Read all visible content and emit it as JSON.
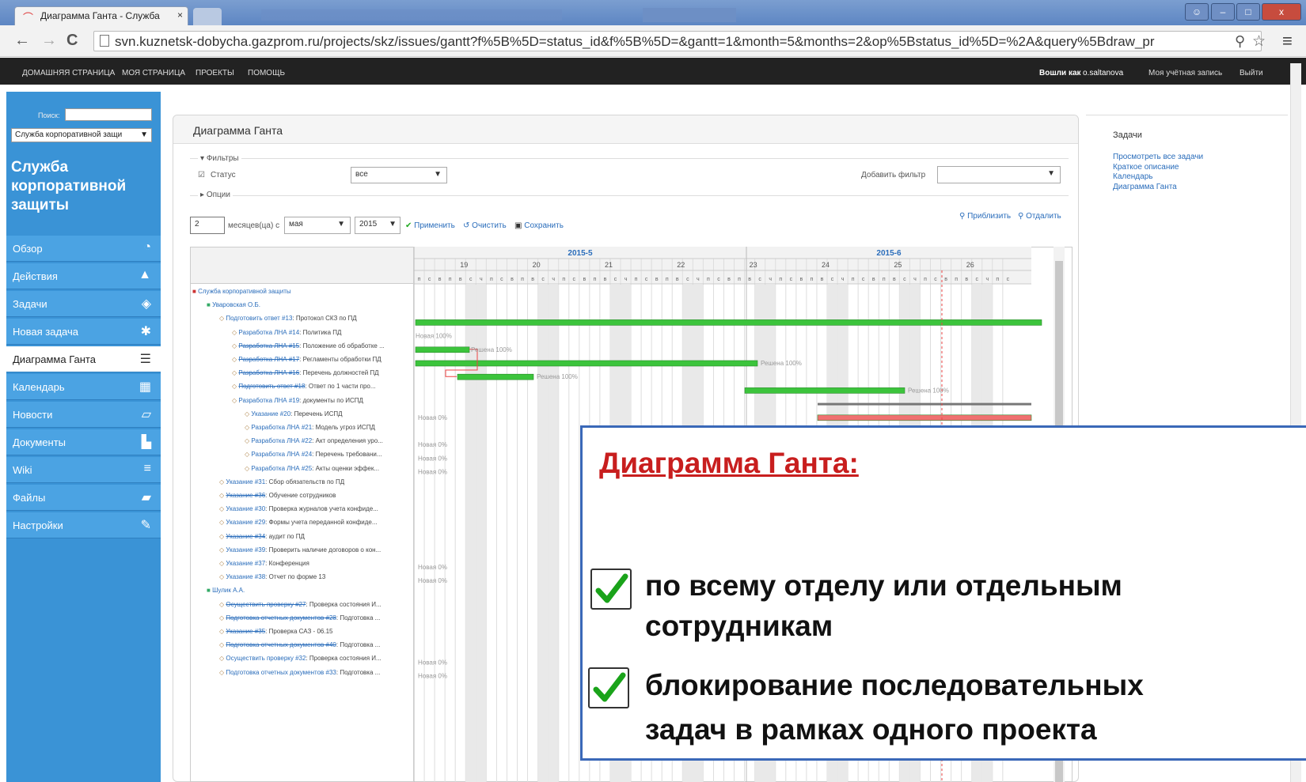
{
  "browser": {
    "tab_title": "Диаграмма Ганта - Служба",
    "url": "svn.kuznetsk-dobycha.gazprom.ru/projects/skz/issues/gantt?f%5B%5D=status_id&f%5B%5D=&gantt=1&month=5&months=2&op%5Bstatus_id%5D=%2A&query%5Bdraw_pr",
    "back": "←",
    "forward": "→",
    "reload": "C",
    "menu": "≡",
    "zoom_icon": "⚲",
    "star": "☆",
    "min": "–",
    "max": "□",
    "close": "x"
  },
  "topnav": {
    "home": "ДОМАШНЯЯ СТРАНИЦА",
    "mypage": "МОЯ СТРАНИЦА",
    "projects": "ПРОЕКТЫ",
    "help": "ПОМОЩЬ",
    "logged": "Вошли как",
    "user": "o.saltanova",
    "account": "Моя учётная запись",
    "logout": "Выйти"
  },
  "sidebar": {
    "search_label": "Поиск:",
    "project_select": "Служба корпоративной защи",
    "project_title": "Служба корпоративной защиты",
    "items": [
      {
        "label": "Обзор",
        "icon": "◔"
      },
      {
        "label": "Действия",
        "icon": "▲"
      },
      {
        "label": "Задачи",
        "icon": "◈"
      },
      {
        "label": "Новая задача",
        "icon": "✱"
      },
      {
        "label": "Диаграмма Ганта",
        "icon": "☰"
      },
      {
        "label": "Календарь",
        "icon": "▦"
      },
      {
        "label": "Новости",
        "icon": "▱"
      },
      {
        "label": "Документы",
        "icon": "▙"
      },
      {
        "label": "Wiki",
        "icon": "≡"
      },
      {
        "label": "Файлы",
        "icon": "▰"
      },
      {
        "label": "Настройки",
        "icon": "✎"
      }
    ]
  },
  "main": {
    "title": "Диаграмма Ганта",
    "filters_label": "Фильтры",
    "status_label": "Статус",
    "status_value": "все",
    "add_filter_label": "Добавить фильтр",
    "options_label": "Опции",
    "zoom_in": "Приблизить",
    "zoom_out": "Отдалить",
    "months_value": "2",
    "months_label": "месяцев(ца) с",
    "month_select": "мая",
    "year_select": "2015",
    "apply": "Применить",
    "clear": "Очистить",
    "save": "Сохранить"
  },
  "gantt": {
    "months": [
      "2015-5",
      "2015-6"
    ],
    "weeks": [
      "19",
      "20",
      "21",
      "22",
      "23",
      "24",
      "25",
      "26"
    ],
    "day_letters": [
      "п",
      "с",
      "в",
      "п",
      "в",
      "с",
      "ч",
      "п",
      "с",
      "в",
      "п",
      "в",
      "с",
      "ч",
      "п",
      "с",
      "в",
      "п",
      "в",
      "с",
      "ч",
      "п",
      "с",
      "в",
      "п",
      "в",
      "с",
      "ч",
      "п",
      "с",
      "в",
      "п",
      "в",
      "с",
      "ч",
      "п",
      "с",
      "в",
      "п",
      "в",
      "с",
      "ч",
      "п",
      "с",
      "в",
      "п",
      "в",
      "с",
      "ч",
      "п",
      "с",
      "в",
      "п",
      "в",
      "с",
      "ч",
      "п",
      "с"
    ],
    "rows": [
      {
        "text": "Служба корпоративной защиты",
        "type": "project"
      },
      {
        "text": "Уваровская О.Б.",
        "type": "user"
      },
      {
        "key": "Подготовить ответ #13",
        "text": ": Протокол СКЗ по ПД",
        "type": "issue"
      },
      {
        "key": "Разработка ЛНА #14",
        "text": ": Политика ПД",
        "type": "issue"
      },
      {
        "key": "Разработка ЛНА #15",
        "text": ": Положение об обработке ...",
        "type": "issue",
        "closed": true
      },
      {
        "key": "Разработка ЛНА #17",
        "text": ": Регламенты обработки ПД",
        "type": "issue",
        "closed": true
      },
      {
        "key": "Разработка ЛНА #16",
        "text": ": Перечень должностей ПД",
        "type": "issue",
        "closed": true
      },
      {
        "key": "Подготовить ответ #18",
        "text": ": Ответ по 1 части про...",
        "type": "issue",
        "closed": true
      },
      {
        "key": "Разработка ЛНА #19",
        "text": ": документы по ИСПД",
        "type": "issue"
      },
      {
        "key": "Указание #20",
        "text": ": Перечень ИСПД",
        "type": "issue",
        "indent": 1
      },
      {
        "key": "Разработка ЛНА #21",
        "text": ": Модель угроз ИСПД",
        "type": "issue",
        "indent": 1
      },
      {
        "key": "Разработка ЛНА #22",
        "text": ": Акт определения уро...",
        "type": "issue",
        "indent": 1
      },
      {
        "key": "Разработка ЛНА #24",
        "text": ": Перечень требовани...",
        "type": "issue",
        "indent": 1
      },
      {
        "key": "Разработка ЛНА #25",
        "text": ": Акты оценки эффек...",
        "type": "issue",
        "indent": 1
      },
      {
        "key": "Указание #31",
        "text": ": Сбор обязательств по ПД",
        "type": "issue"
      },
      {
        "key": "Указание #36",
        "text": ": Обучение сотрудников",
        "type": "issue",
        "closed": true
      },
      {
        "key": "Указание #30",
        "text": ": Проверка журналов учета конфиде...",
        "type": "issue"
      },
      {
        "key": "Указание #29",
        "text": ": Формы учета переданной конфиде...",
        "type": "issue"
      },
      {
        "key": "Указание #34",
        "text": ": аудит по ПД",
        "type": "issue",
        "closed": true
      },
      {
        "key": "Указание #39",
        "text": ": Проверить наличие договоров о кон...",
        "type": "issue"
      },
      {
        "key": "Указание #37",
        "text": ": Конференция",
        "type": "issue"
      },
      {
        "key": "Указание #38",
        "text": ": Отчет по форме 13",
        "type": "issue"
      },
      {
        "text": "Шулик А.А.",
        "type": "user"
      },
      {
        "key": "Осуществить проверку #27",
        "text": ": Проверка состояния И...",
        "type": "issue",
        "closed": true
      },
      {
        "key": "Подготовка отчетных документов #28",
        "text": ": Подготовка ...",
        "type": "issue",
        "closed": true
      },
      {
        "key": "Указание #35",
        "text": ": Проверка САЗ - 06.15",
        "type": "issue",
        "closed": true
      },
      {
        "key": "Подготовка отчетных документов #40",
        "text": ": Подготовка ...",
        "type": "issue",
        "closed": true
      },
      {
        "key": "Осуществить проверку #32",
        "text": ": Проверка состояния И...",
        "type": "issue"
      },
      {
        "key": "Подготовка отчетных документов #33",
        "text": ": Подготовка ...",
        "type": "issue"
      }
    ],
    "bar_labels": [
      {
        "row": 3,
        "text": "Новая 100%"
      },
      {
        "row": 4,
        "text": "Решена 100%"
      },
      {
        "row": 5,
        "text": "Решена 100%"
      },
      {
        "row": 6,
        "text": "Решена 100%"
      },
      {
        "row": 7,
        "text": "Решена 100%"
      },
      {
        "row": 9,
        "text": "Новая 0%"
      },
      {
        "row": 11,
        "text": "Новая 0%"
      },
      {
        "row": 12,
        "text": "Новая 0%"
      },
      {
        "row": 13,
        "text": "Новая 0%"
      },
      {
        "row": 20,
        "text": "Новая 0%"
      },
      {
        "row": 21,
        "text": "Новая 0%"
      },
      {
        "row": 27,
        "text": "Новая 0%"
      },
      {
        "row": 28,
        "text": "Новая 0%"
      }
    ]
  },
  "right": {
    "title": "Задачи",
    "links": [
      "Просмотреть все задачи",
      "Краткое описание",
      "Календарь",
      "Диаграмма Ганта"
    ]
  },
  "overlay": {
    "title": "Диаграмма Ганта:",
    "point1_line1": "по всему отделу или отдельным",
    "point1_line2": "сотрудникам",
    "point2_line1": "блокирование последовательных",
    "point2_line2": "задач в рамках одного проекта"
  },
  "colors": {
    "accent": "#3a93d6",
    "bar_done": "#3cc43c",
    "bar_late": "#f07070",
    "title_red": "#c81e1e"
  }
}
